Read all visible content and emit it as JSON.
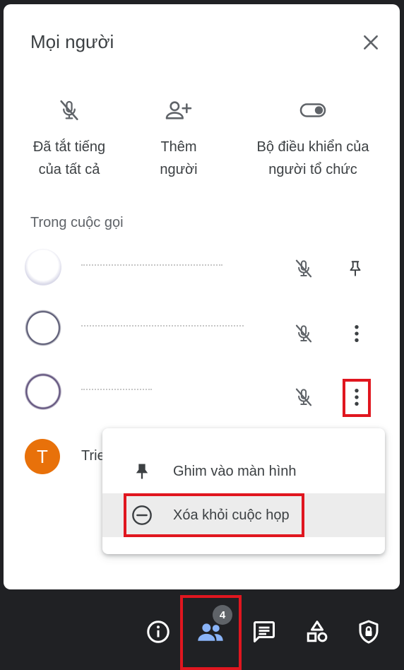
{
  "panel": {
    "title": "Mọi người",
    "close_icon": "close-icon"
  },
  "actions": [
    {
      "label": "Đã tắt tiếng\ncủa tất cả",
      "icon": "mic-off-icon"
    },
    {
      "label": "Thêm\nngười",
      "icon": "person-add-icon"
    },
    {
      "label": "Bộ điều khiển của\nngười tổ chức",
      "icon": "toggle-icon"
    }
  ],
  "section_title": "Trong cuộc gọi",
  "participants": [
    {
      "name": "",
      "mic": "mic-off-icon",
      "action": "pin-icon"
    },
    {
      "name": "",
      "mic": "mic-off-icon",
      "action": "more-vert-icon"
    },
    {
      "name": "",
      "mic": "mic-off-icon",
      "action": "more-vert-icon"
    },
    {
      "name": "Trie",
      "avatar_letter": "T",
      "avatar_color": "#e8710a"
    }
  ],
  "context_menu": {
    "items": [
      {
        "label": "Ghim vào màn hình",
        "icon": "pin-icon"
      },
      {
        "label": "Xóa khỏi cuộc họp",
        "icon": "remove-circle-icon"
      }
    ]
  },
  "bottom_bar": {
    "items": [
      {
        "icon": "info-icon"
      },
      {
        "icon": "people-icon",
        "badge": "4"
      },
      {
        "icon": "chat-icon"
      },
      {
        "icon": "activities-icon"
      },
      {
        "icon": "host-controls-icon"
      }
    ]
  },
  "colors": {
    "highlight": "#e0161f",
    "active_people": "#8ab4f8",
    "panel_text": "#3c4043",
    "avatar_t": "#e8710a"
  }
}
